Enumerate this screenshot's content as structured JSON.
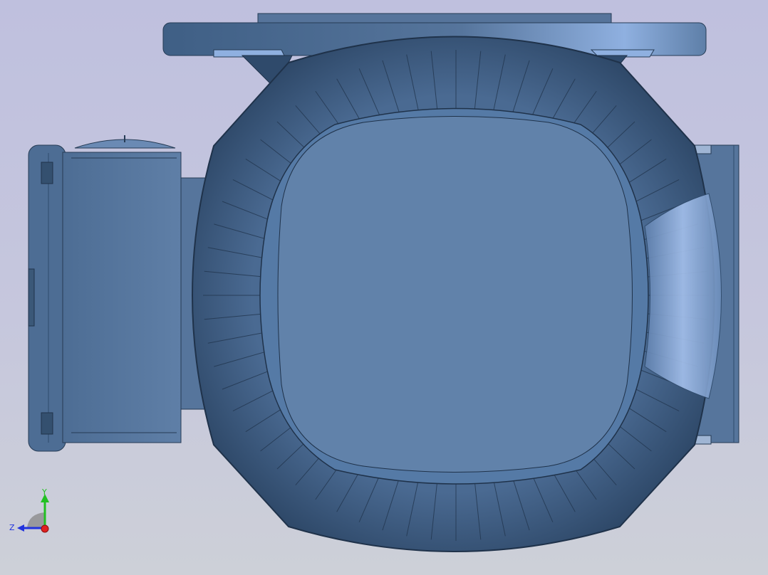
{
  "view": {
    "background_top": "#bfc0de",
    "background_bottom": "#cdd0d8",
    "model_face_color": "#6a8ab4",
    "model_dark_color": "#34506f",
    "model_highlight_color": "#a9c4ee"
  },
  "triad": {
    "y_label": "Y",
    "z_label": "Z",
    "y_color": "#22c022",
    "z_color": "#2233dd",
    "x_color": "#e02020"
  }
}
